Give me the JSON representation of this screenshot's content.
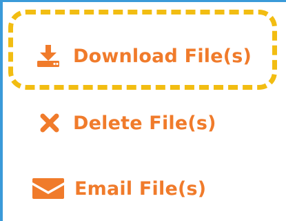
{
  "menu": {
    "items": [
      {
        "label": "Download File(s)",
        "icon": "download-icon"
      },
      {
        "label": "Delete File(s)",
        "icon": "close-icon"
      },
      {
        "label": "Email File(s)",
        "icon": "envelope-icon"
      }
    ],
    "highlighted_item": "Download File(s)"
  },
  "colors": {
    "accent": "#f07b2b",
    "highlight": "#f2bd12",
    "frame": "#3a9ad9",
    "background": "#ffffff"
  }
}
